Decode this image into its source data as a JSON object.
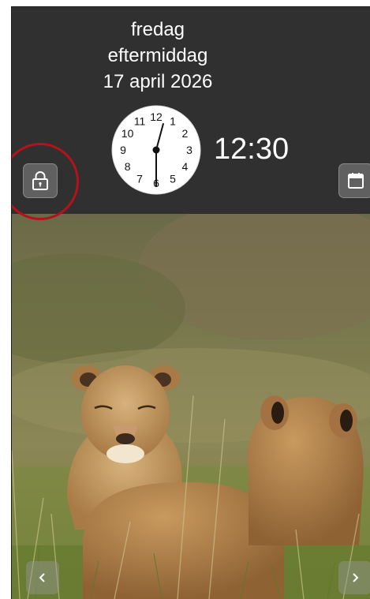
{
  "header": {
    "weekday": "fredag",
    "daypart": "eftermiddag",
    "date": "17 april 2026",
    "digital_time": "12:30"
  },
  "clock": {
    "numbers": [
      "12",
      "1",
      "2",
      "3",
      "4",
      "5",
      "6",
      "7",
      "8",
      "9",
      "10",
      "11"
    ],
    "hour": 12,
    "minute": 30
  },
  "buttons": {
    "lock_icon": "lock-icon",
    "calendar_icon": "calendar-icon",
    "prev_icon": "chevron-left-icon",
    "next_icon": "chevron-right-icon"
  },
  "colors": {
    "header_bg": "#303030",
    "text": "#ffffff",
    "highlight_ring": "#b5121b"
  }
}
